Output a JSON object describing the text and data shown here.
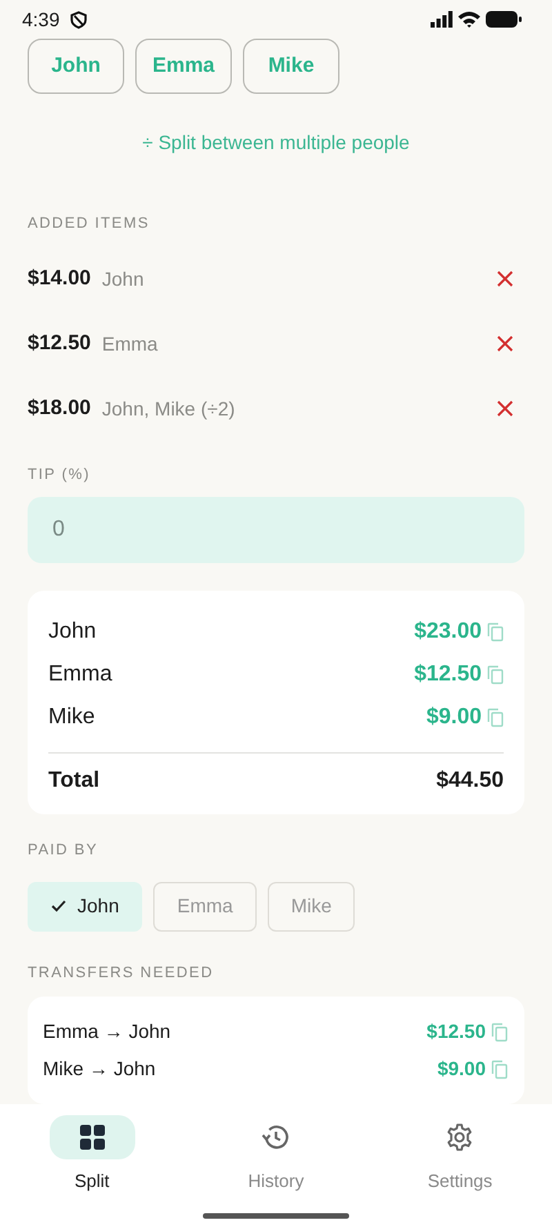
{
  "status_bar": {
    "time": "4:39"
  },
  "people": [
    {
      "name": "John"
    },
    {
      "name": "Emma"
    },
    {
      "name": "Mike"
    }
  ],
  "split_link": "÷ Split between multiple people",
  "added_items": {
    "heading": "ADDED ITEMS",
    "items": [
      {
        "amount": "$14.00",
        "people": "John"
      },
      {
        "amount": "$12.50",
        "people": "Emma"
      },
      {
        "amount": "$18.00",
        "people": "John, Mike (÷2)"
      }
    ]
  },
  "tip": {
    "label": "TIP (%)",
    "placeholder": "0"
  },
  "summary": {
    "rows": [
      {
        "name": "John",
        "amount": "$23.00"
      },
      {
        "name": "Emma",
        "amount": "$12.50"
      },
      {
        "name": "Mike",
        "amount": "$9.00"
      }
    ],
    "total_label": "Total",
    "total": "$44.50"
  },
  "paid_by": {
    "heading": "PAID BY",
    "options": [
      {
        "name": "John",
        "selected": true
      },
      {
        "name": "Emma",
        "selected": false
      },
      {
        "name": "Mike",
        "selected": false
      }
    ]
  },
  "transfers": {
    "heading": "TRANSFERS NEEDED",
    "rows": [
      {
        "text": "Emma → John",
        "amount": "$12.50"
      },
      {
        "text": "Mike → John",
        "amount": "$9.00"
      }
    ]
  },
  "nav": [
    {
      "kind": "grid",
      "label": "Split",
      "selected": true
    },
    {
      "kind": "history",
      "label": "History",
      "selected": false
    },
    {
      "kind": "settings",
      "label": "Settings",
      "selected": false
    }
  ]
}
